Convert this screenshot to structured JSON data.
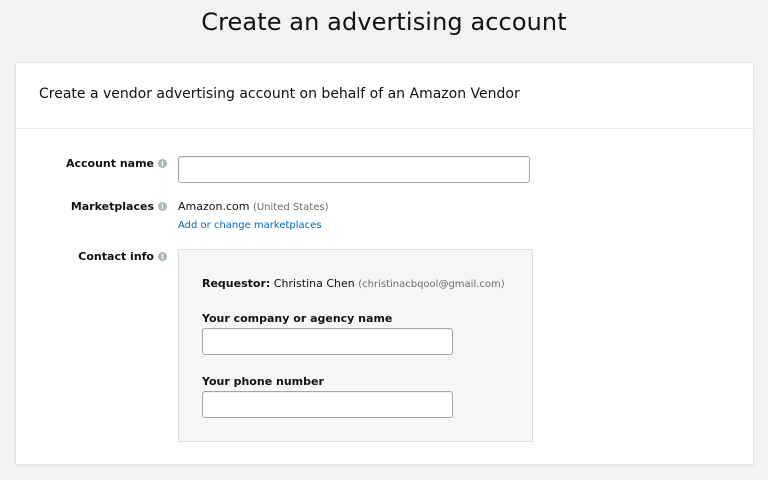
{
  "page": {
    "title": "Create an advertising account"
  },
  "card": {
    "header": "Create a vendor advertising account on behalf of an Amazon Vendor"
  },
  "form": {
    "account_name": {
      "label": "Account name",
      "value": "",
      "icon": "info-icon"
    },
    "marketplaces": {
      "label": "Marketplaces",
      "selected_marketplace": "Amazon.com",
      "selected_region": "(United States)",
      "change_link": "Add or change marketplaces",
      "icon": "info-icon"
    },
    "contact_info": {
      "label": "Contact info",
      "icon": "info-icon",
      "requestor_label": "Requestor:",
      "requestor_name": "Christina Chen",
      "requestor_email": "(christinacbqool@gmail.com)",
      "company_label": "Your company or agency name",
      "company_value": "",
      "phone_label": "Your phone number",
      "phone_value": ""
    }
  },
  "colors": {
    "background": "#f2f3f3",
    "link": "#0066c0",
    "info_icon": "#aab7b8",
    "contact_box_bg": "#f7f7f7"
  }
}
